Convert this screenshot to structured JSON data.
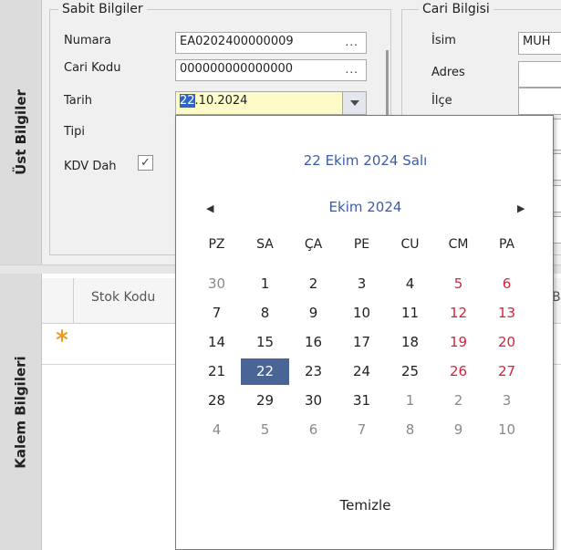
{
  "tabs": {
    "ust_bilgiler": "Üst Bilgiler",
    "kalem_bilgileri": "Kalem Bilgileri"
  },
  "sabit": {
    "title": "Sabit Bilgiler",
    "numara_label": "Numara",
    "numara_value": "EA0202400000009",
    "cari_kodu_label": "Cari Kodu",
    "cari_kodu_value": "000000000000000",
    "tarih_label": "Tarih",
    "tarih_day": "22",
    "tarih_rest": ".10.2024",
    "tipi_label": "Tipi",
    "kdv_label": "KDV Dah",
    "kdv_checked": "✓",
    "ellipsis": "..."
  },
  "cari": {
    "title": "Cari Bilgisi",
    "isim_label": "İsim",
    "isim_value": "MUH",
    "adres_label": "Adres",
    "ilce_label": "İlçe"
  },
  "grid": {
    "col_stok_kodu": "Stok Kodu",
    "col_partial": "Ba",
    "new_row_icon": "asterisk-icon"
  },
  "calendar": {
    "today_text": "22 Ekim 2024 Salı",
    "month_text": "Ekim 2024",
    "prev_arrow": "◀",
    "next_arrow": "▶",
    "weekdays": [
      "PZ",
      "SA",
      "ÇA",
      "PE",
      "CU",
      "CM",
      "PA"
    ],
    "weeks": [
      [
        "30",
        "1",
        "2",
        "3",
        "4",
        "5",
        "6"
      ],
      [
        "7",
        "8",
        "9",
        "10",
        "11",
        "12",
        "13"
      ],
      [
        "14",
        "15",
        "16",
        "17",
        "18",
        "19",
        "20"
      ],
      [
        "21",
        "22",
        "23",
        "24",
        "25",
        "26",
        "27"
      ],
      [
        "28",
        "29",
        "30",
        "31",
        "1",
        "2",
        "3"
      ],
      [
        "4",
        "5",
        "6",
        "7",
        "8",
        "9",
        "10"
      ]
    ],
    "selected_day": "22",
    "clear_label": "Temizle",
    "colors": {
      "accent": "#3b5da8",
      "selected_bg": "#4a6595",
      "weekend": "#d6233a",
      "other_month": "#8a8a8a"
    }
  }
}
